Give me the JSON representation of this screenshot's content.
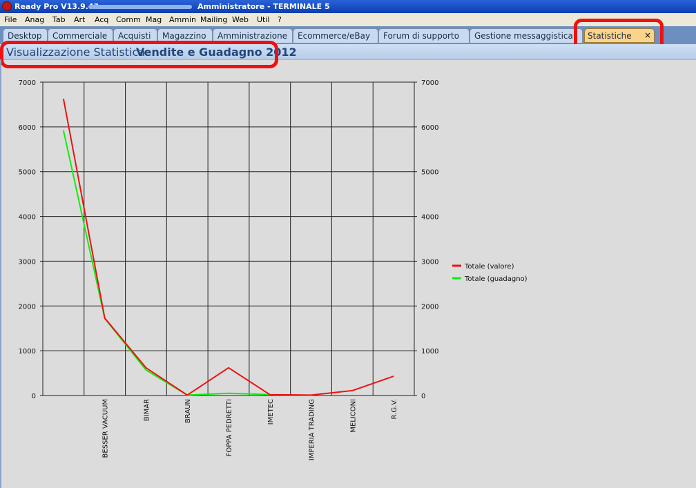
{
  "window": {
    "app_name": "Ready Pro V13.9.43 -",
    "title": "Amministratore - TERMINALE 5"
  },
  "menu": [
    "File",
    "Anag",
    "Tab",
    "Art",
    "Acq",
    "Comm",
    "Mag",
    "Ammin",
    "Mailing",
    "Web",
    "Util",
    "?"
  ],
  "tabs": [
    "Desktop",
    "Commerciale",
    "Acquisti",
    "Magazzino",
    "Amministrazione",
    "Ecommerce/eBay",
    "Forum di supporto",
    "Gestione messaggistica",
    "Statistiche"
  ],
  "active_tab_close": "×",
  "header": {
    "prefix": "Visualizzazione Statistica:",
    "subject": "Vendite e Guadagno 2012"
  },
  "colors": {
    "highlight": "#ee1111",
    "valore": "#ee1111",
    "guadagno": "#11ee11"
  },
  "chart_data": {
    "type": "line",
    "categories": [
      "",
      "BESSER VACUUM",
      "BIMAR",
      "BRAUN",
      "FOPPA PEDRETTI",
      "IMETEC",
      "IMPERIA TRADING",
      "MELICONI",
      "R.G.V."
    ],
    "series": [
      {
        "name": "Totale (valore)",
        "color": "#ee1111",
        "values": [
          6630,
          1730,
          620,
          10,
          620,
          20,
          10,
          110,
          430
        ]
      },
      {
        "name": "Totale (guadagno)",
        "color": "#11ee11",
        "values": [
          5920,
          1720,
          570,
          10,
          50,
          20,
          null,
          null,
          null
        ]
      }
    ],
    "ylim": [
      0,
      7000
    ],
    "yticks": [
      "0",
      "1000",
      "2000",
      "3000",
      "4000",
      "5000",
      "6000",
      "7000"
    ],
    "grid": true,
    "legend": "right"
  }
}
